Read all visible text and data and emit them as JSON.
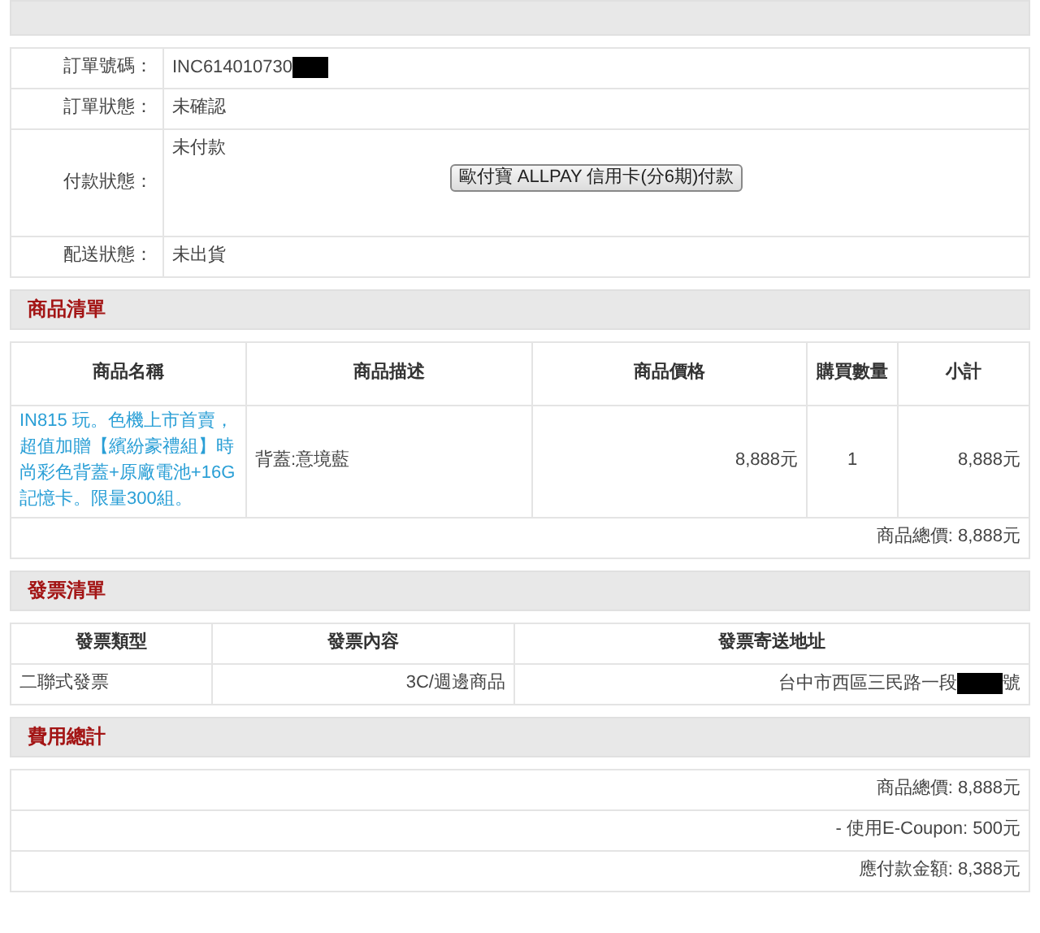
{
  "order_info": {
    "rows": [
      {
        "label": "訂單號碼：",
        "value": "INC614010730",
        "redacted": true
      },
      {
        "label": "訂單狀態：",
        "value": "未確認",
        "redacted": false
      },
      {
        "label": "付款狀態：",
        "value": "未付款",
        "redacted": false,
        "button": "歐付寶 ALLPAY 信用卡(分6期)付款"
      },
      {
        "label": "配送狀態：",
        "value": "未出貨",
        "redacted": false
      }
    ]
  },
  "products": {
    "title": "商品清單",
    "columns": [
      "商品名稱",
      "商品描述",
      "商品價格",
      "購買數量",
      "小計"
    ],
    "rows": [
      {
        "name": "IN815 玩。色機上市首賣，超值加贈【繽紛豪禮組】時尚彩色背蓋+原廠電池+16G記憶卡。限量300組。",
        "description": "背蓋:意境藍",
        "price": "8,888元",
        "quantity": "1",
        "subtotal": "8,888元"
      }
    ],
    "total": "商品總價: 8,888元"
  },
  "invoice": {
    "title": "發票清單",
    "columns": [
      "發票類型",
      "發票內容",
      "發票寄送地址"
    ],
    "rows": [
      {
        "type": "二聯式發票",
        "content": "3C/週邊商品",
        "address": "台中市西區三民路一段",
        "address_redacted": true,
        "address_suffix": "號"
      }
    ]
  },
  "costs": {
    "title": "費用總計",
    "lines": [
      "商品總價: 8,888元",
      "- 使用E-Coupon: 500元",
      "應付款金額: 8,388元"
    ]
  }
}
